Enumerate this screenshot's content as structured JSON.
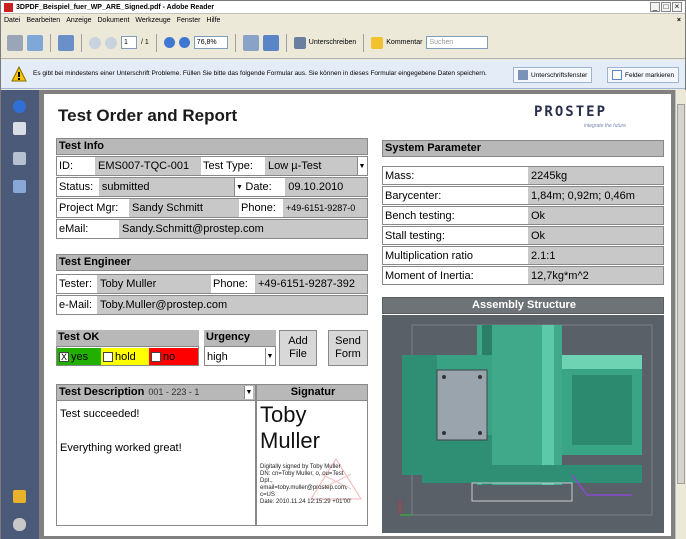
{
  "window": {
    "title": "3DPDF_Beispiel_fuer_WP_ARE_Signed.pdf - Adobe Reader",
    "controls": [
      "_",
      "□",
      "×"
    ]
  },
  "menu": [
    "Datei",
    "Bearbeiten",
    "Anzeige",
    "Dokument",
    "Werkzeuge",
    "Fenster",
    "Hilfe"
  ],
  "menu_close": "×",
  "toolbar": {
    "page_current": "1",
    "page_total": "/ 1",
    "zoom": "76,8%",
    "sign_label": "Unterschreiben",
    "comment_label": "Kommentar",
    "search_placeholder": "Suchen"
  },
  "message_bar": {
    "text": "Es gibt bei mindestens einer Unterschrift Probleme.  Füllen Sie bitte das folgende Formular aus. Sie können in dieses Formular eingegebene Daten speichern.",
    "signature_panel_button": "Unterschriftsfenster",
    "highlight_fields_button": "Felder markieren"
  },
  "form": {
    "title": "Test Order and Report",
    "logo": "PROSTEP",
    "logo_tagline": "integrate the future",
    "test_info": {
      "heading": "Test Info",
      "id_label": "ID:",
      "id_value": "EMS007-TQC-001",
      "type_label": "Test Type:",
      "type_value": "Low µ-Test",
      "status_label": "Status:",
      "status_value": "submitted",
      "date_label": "Date:",
      "date_value": "09.10.2010",
      "pm_label": "Project Mgr:",
      "pm_value": "Sandy Schmitt",
      "phone_label": "Phone:",
      "phone_value": "+49-6151-9287-0",
      "email_label": "eMail:",
      "email_value": "Sandy.Schmitt@prostep.com"
    },
    "test_engineer": {
      "heading": "Test Engineer",
      "tester_label": "Tester:",
      "tester_value": "Toby Muller",
      "phone_label": "Phone:",
      "phone_value": "+49-6151-9287-392",
      "email_label": "e-Mail:",
      "email_value": "Toby.Muller@prostep.com"
    },
    "test_ok": {
      "heading": "Test OK",
      "yes": "yes",
      "hold": "hold",
      "no": "no",
      "yes_checked": "X"
    },
    "urgency": {
      "heading": "Urgency",
      "value": "high"
    },
    "add_file": [
      "Add",
      "File"
    ],
    "send_form": [
      "Send",
      "Form"
    ],
    "description": {
      "heading": "Test Description",
      "code": "001 - 223 - 1",
      "line1": "Test succeeded!",
      "line2": "Everything worked great!"
    },
    "signature": {
      "heading": "Signatur",
      "name_line1": "Toby",
      "name_line2": "Muller",
      "details": [
        "Digitally signed by Toby Muller",
        "DN: cn=Toby Muller, o, ou=Test",
        "Dpt.,",
        "email=toby.muller@prostep.com,",
        "c=US",
        "Date: 2010.11.24 12:15:29 +01'00'"
      ]
    },
    "system_parameter": {
      "heading": "System Parameter",
      "rows": [
        {
          "label": "Mass:",
          "value": "2245kg"
        },
        {
          "label": "Barycenter:",
          "value": "1,84m; 0,92m; 0,46m"
        },
        {
          "label": "Bench testing:",
          "value": "Ok"
        },
        {
          "label": "Stall testing:",
          "value": "Ok"
        },
        {
          "label": "Multiplication ratio",
          "value": "2.1:1"
        },
        {
          "label": "Moment of Inertia:",
          "value": "12,7kg*m^2"
        }
      ]
    },
    "assembly": {
      "heading": "Assembly Structure"
    }
  },
  "colors": {
    "accent_red": "#c8201e",
    "yes_green": "#22b000",
    "hold_yellow": "#ffff00",
    "no_red": "#ff0000",
    "teal_model": "#3fa98a"
  }
}
